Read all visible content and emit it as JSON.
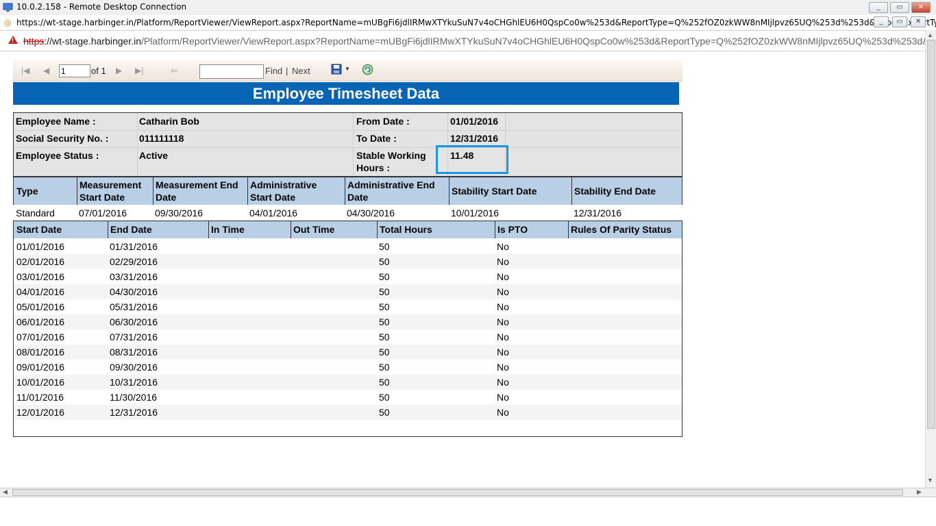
{
  "window": {
    "title": "10.0.2.158 - Remote Desktop Connection",
    "inner_url": "https://wt-stage.harbinger.in/Platform/ReportViewer/ViewReport.aspx?ReportName=mUBgFi6jdlIRMwXTYkuSuN7v4oCHGhlEU6H0QspCo0w%253d&ReportType=Q%252fOZ0zkWW8nMIjlpvz65UQ%253d%253d&ReportExportType=WC...",
    "address_scheme": "https",
    "address_host": "://wt-stage.harbinger.in",
    "address_path": "/Platform/ReportViewer/ViewReport.aspx?ReportName=mUBgFi6jdlIRMwXTYkuSuN7v4oCHGhlEU6H0QspCo0w%253d&ReportType=Q%252fOZ0zkWW8nMIjlpvz65UQ%253d%253d&R"
  },
  "toolbar": {
    "page_value": "1",
    "of_label": "of 1",
    "find_label": "Find",
    "separator": "|",
    "next_label": "Next"
  },
  "report": {
    "title": "Employee Timesheet Data",
    "employee_name_label": "Employee Name :",
    "employee_name": "Catharin Bob",
    "ssn_label": "Social Security No. :",
    "ssn": "011111118",
    "status_label": "Employee Status :",
    "status": "Active",
    "from_date_label": "From Date :",
    "from_date": "01/01/2016",
    "to_date_label": "To Date :",
    "to_date": "12/31/2016",
    "stable_hours_label_1": "Stable Working",
    "stable_hours_label_2": "Hours :",
    "stable_hours": "11.48"
  },
  "measurement": {
    "headers": [
      {
        "l1": "Type",
        "l2": ""
      },
      {
        "l1": "Measurement",
        "l2": "Start Date"
      },
      {
        "l1": "Measurement End",
        "l2": "Date"
      },
      {
        "l1": "Administrative",
        "l2": "Start Date"
      },
      {
        "l1": "Administrative End",
        "l2": "Date"
      },
      {
        "l1": "Stability Start Date",
        "l2": ""
      },
      {
        "l1": "Stability End Date",
        "l2": ""
      }
    ],
    "row": [
      "Standard",
      "07/01/2016",
      "09/30/2016",
      "04/01/2016",
      "04/30/2016",
      "10/01/2016",
      "12/31/2016"
    ]
  },
  "timesheet": {
    "headers": [
      "Start Date",
      "End Date",
      "In Time",
      "Out Time",
      "Total Hours",
      "Is PTO",
      "Rules Of Parity Status"
    ],
    "rows": [
      [
        "01/01/2016",
        "01/31/2016",
        "",
        "",
        "50",
        "No",
        ""
      ],
      [
        "02/01/2016",
        "02/29/2016",
        "",
        "",
        "50",
        "No",
        ""
      ],
      [
        "03/01/2016",
        "03/31/2016",
        "",
        "",
        "50",
        "No",
        ""
      ],
      [
        "04/01/2016",
        "04/30/2016",
        "",
        "",
        "50",
        "No",
        ""
      ],
      [
        "05/01/2016",
        "05/31/2016",
        "",
        "",
        "50",
        "No",
        ""
      ],
      [
        "06/01/2016",
        "06/30/2016",
        "",
        "",
        "50",
        "No",
        ""
      ],
      [
        "07/01/2016",
        "07/31/2016",
        "",
        "",
        "50",
        "No",
        ""
      ],
      [
        "08/01/2016",
        "08/31/2016",
        "",
        "",
        "50",
        "No",
        ""
      ],
      [
        "09/01/2016",
        "09/30/2016",
        "",
        "",
        "50",
        "No",
        ""
      ],
      [
        "10/01/2016",
        "10/31/2016",
        "",
        "",
        "50",
        "No",
        ""
      ],
      [
        "11/01/2016",
        "11/30/2016",
        "",
        "",
        "50",
        "No",
        ""
      ],
      [
        "12/01/2016",
        "12/31/2016",
        "",
        "",
        "50",
        "No",
        ""
      ]
    ]
  }
}
